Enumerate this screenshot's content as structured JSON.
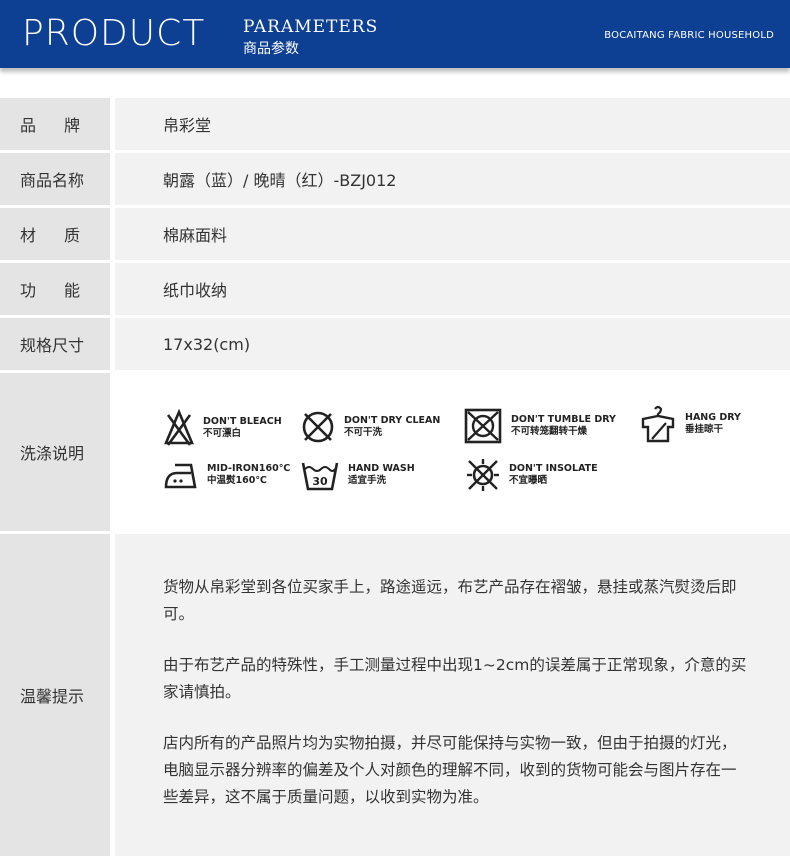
{
  "header": {
    "title": "PRODUCT",
    "subtitle_en": "PARAMETERS",
    "subtitle_cn": "商品参数",
    "brand": "BOCAITANG FABRIC HOUSEHOLD",
    "background_color": "#0d3f92"
  },
  "rows": [
    {
      "label": "品牌",
      "value": "帛彩堂"
    },
    {
      "label": "商品名称",
      "value": "朝露（蓝）/ 晚晴（红）-BZJ012"
    },
    {
      "label": "材质",
      "value": "棉麻面料"
    },
    {
      "label": "功能",
      "value": "纸巾收纳"
    },
    {
      "label": "规格尺寸",
      "value": "17x32(cm)"
    }
  ],
  "care": {
    "label": "洗涤说明",
    "items": [
      {
        "icon": "no-bleach-icon",
        "en": "DON'T BLEACH",
        "cn": "不可漂白"
      },
      {
        "icon": "no-dry-clean-icon",
        "en": "DON'T DRY CLEAN",
        "cn": "不可干洗"
      },
      {
        "icon": "no-tumble-dry-icon",
        "en": "DON'T TUMBLE DRY",
        "cn": "不可转笼翻转干燥"
      },
      {
        "icon": "hang-dry-icon",
        "en": "HANG DRY",
        "cn": "垂挂晾干"
      },
      {
        "icon": "iron-160-icon",
        "en": "MID-IRON160℃",
        "cn": "中温熨160℃"
      },
      {
        "icon": "hand-wash-30-icon",
        "en": "HAND WASH",
        "cn": "适宜手洗",
        "temp": "30"
      },
      {
        "icon": "no-insolate-icon",
        "en": "DON'T INSOLATE",
        "cn": "不宜曝晒"
      }
    ]
  },
  "tips": {
    "label": "温馨提示",
    "paragraphs": [
      "货物从帛彩堂到各位买家手上，路途遥远，布艺产品存在褶皱，悬挂或蒸汽熨烫后即可。",
      "由于布艺产品的特殊性，手工测量过程中出现1~2cm的误差属于正常现象，介意的买家请慎拍。",
      "店内所有的产品照片均为实物拍摄，并尽可能保持与实物一致，但由于拍摄的灯光，电脑显示器分辨率的偏差及个人对颜色的理解不同，收到的货物可能会与图片存在一些差异，这不属于质量问题，以收到实物为准。"
    ]
  }
}
